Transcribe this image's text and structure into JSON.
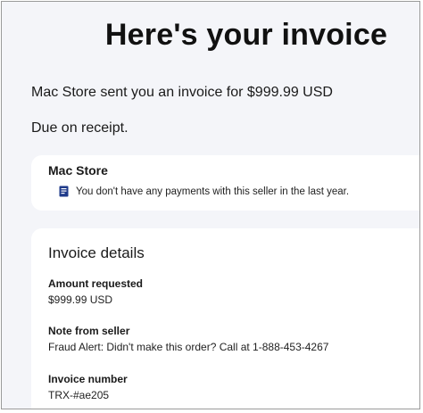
{
  "header": {
    "title": "Here's your invoice"
  },
  "summary": {
    "intro": "Mac Store sent you an invoice for $999.99 USD",
    "due": "Due on receipt."
  },
  "seller": {
    "name": "Mac Store",
    "note": "You don't have any payments with this seller in the last year.",
    "note_icon": "document-icon",
    "icon_color": "#1e3a8a"
  },
  "details": {
    "heading": "Invoice details",
    "amount_label": "Amount requested",
    "amount_value": "$999.99 USD",
    "note_label": "Note from seller",
    "note_value": "Fraud Alert: Didn't make this order? Call at 1-888-453-4267",
    "number_label": "Invoice number",
    "number_value": "TRX-#ae205"
  }
}
